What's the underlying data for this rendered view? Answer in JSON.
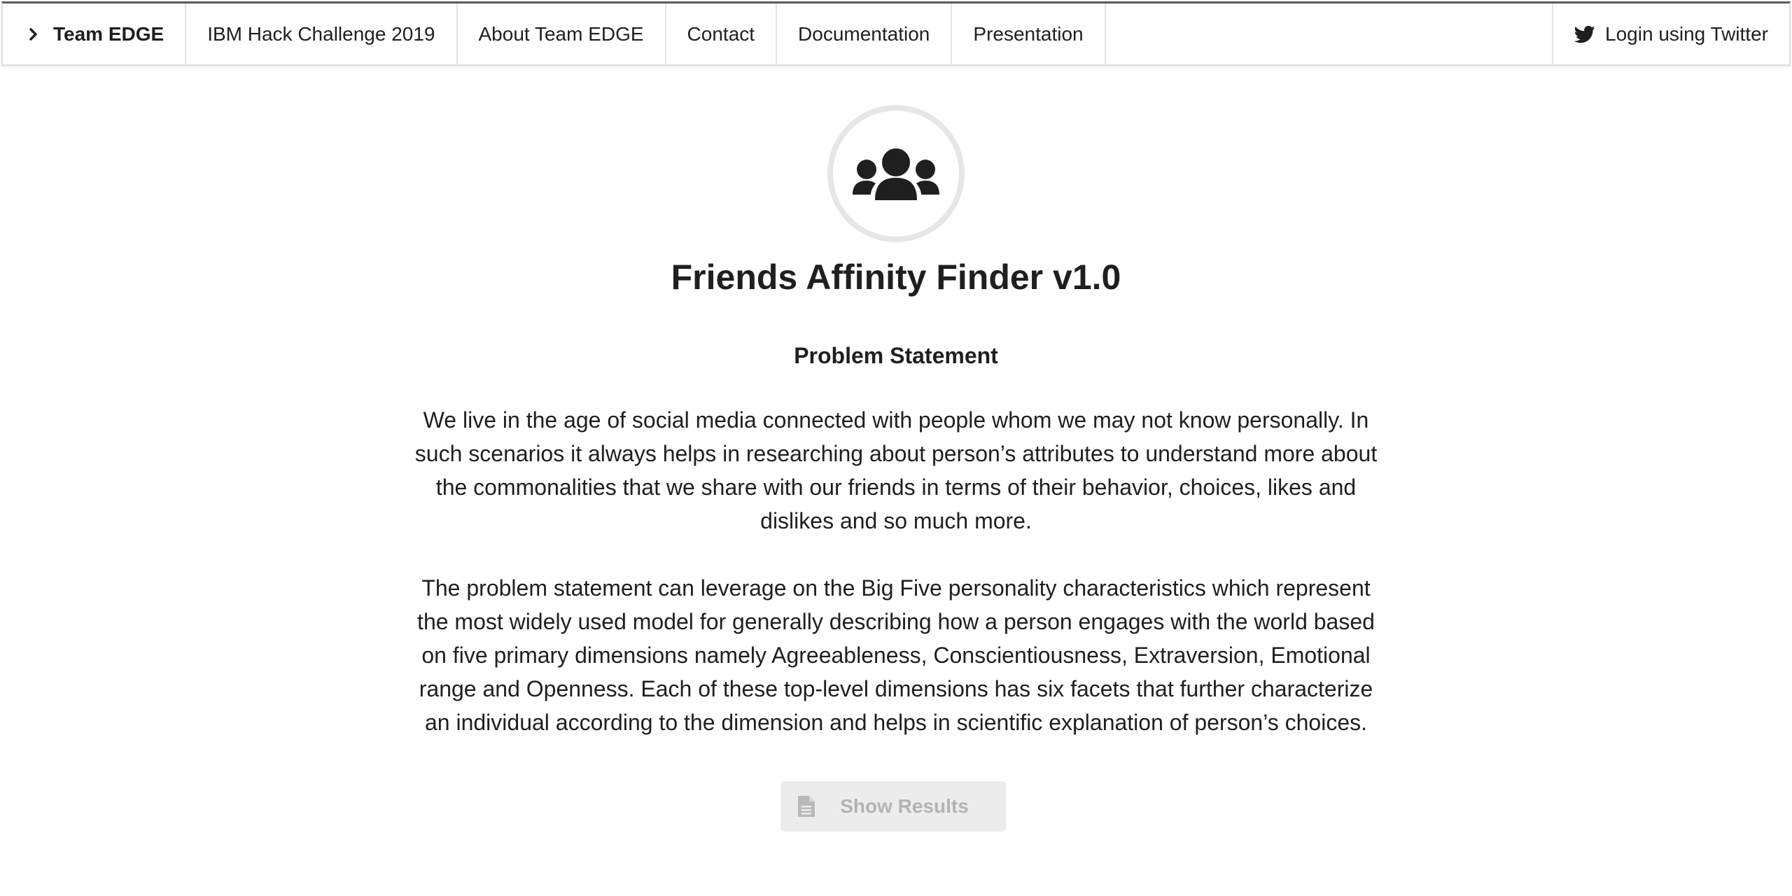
{
  "navbar": {
    "brand": "Team EDGE",
    "items": [
      {
        "label": "IBM Hack Challenge 2019"
      },
      {
        "label": "About Team EDGE"
      },
      {
        "label": "Contact"
      },
      {
        "label": "Documentation"
      },
      {
        "label": "Presentation"
      }
    ],
    "login_label": "Login using Twitter"
  },
  "main": {
    "icon": "users-icon",
    "title": "Friends Affinity Finder v1.0",
    "section_heading": "Problem Statement",
    "paragraphs": [
      "We live in the age of social media connected with people whom we may not know personally. In such scenarios it always helps in researching about person’s attributes to understand more about the commonalities that we share with our friends in terms of their behavior, choices, likes and dislikes and so much more.",
      "The problem statement can leverage on the Big Five personality characteristics which represent the most widely used model for generally describing how a person engages with the world based on five primary dimensions namely Agreeableness, Conscientiousness, Extraversion, Emotional range and Openness. Each of these top-level dimensions has six facets that further characterize an individual according to the dimension and helps in scientific explanation of person’s choices."
    ],
    "button_label": "Show Results",
    "button_state": "disabled"
  },
  "colors": {
    "text": "#1f1f1f",
    "ring": "#e6e6e6",
    "button_bg": "#ececec",
    "button_text": "#b3b3b3"
  }
}
